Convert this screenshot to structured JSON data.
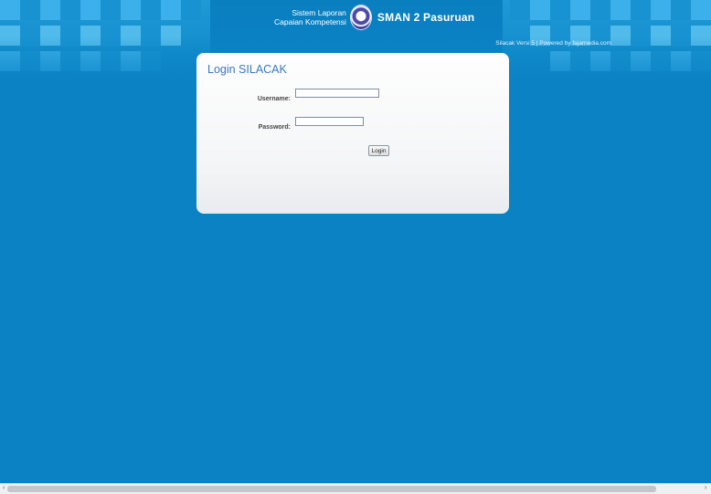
{
  "header": {
    "subtitle_line1": "Sistem Laporan",
    "subtitle_line2": "Capaian Kompetensi",
    "school_name": "SMAN 2 Pasuruan",
    "version_text": "Silacak Versi 5 | Powered by fajarnedia.com"
  },
  "login": {
    "title": "Login SILACAK",
    "username_label": "Username:",
    "username_value": "",
    "password_label": "Password:",
    "password_value": "",
    "submit_label": "Login"
  },
  "icons": {
    "logo": "school-emblem-icon",
    "scroll_left": "chevron-left-icon",
    "scroll_right": "chevron-right-icon"
  },
  "colors": {
    "background": "#0a82c4",
    "title": "#3a78c2",
    "panel": "#f5f6f7"
  }
}
